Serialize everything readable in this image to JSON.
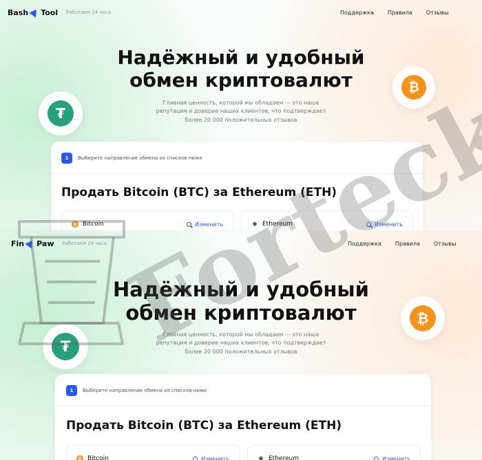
{
  "top": {
    "logo": {
      "left": "Bash",
      "right": "Tool"
    },
    "hours": "Работаем 24 часа",
    "nav": [
      "Поддержка",
      "Правила",
      "Отзывы"
    ]
  },
  "bottom": {
    "logo": {
      "left": "Fin",
      "right": "Paw"
    },
    "hours": "Работаем 24 часа",
    "nav": [
      "Поддержка",
      "Правила",
      "Отзывы"
    ]
  },
  "hero": {
    "title_line1": "Надёжный и удобный",
    "title_line2": "обмен криптовалют",
    "subtitle_line1": "Главная ценность, которой мы обладаем — это наша",
    "subtitle_line2": "репутация и доверие наших клиентов, что подтверждает",
    "subtitle_line3": "более 20 000 положительных отзывов"
  },
  "exchange": {
    "step_number": "1",
    "step_text": "Выберите направление обмена из списков ниже",
    "title": "Продать Bitcoin (BTC) за Ethereum (ETH)",
    "from": {
      "coin": "Bitcoin",
      "change_label": "Изменить"
    },
    "to": {
      "coin": "Ethereum",
      "change_label": "Изменить"
    }
  },
  "watermark": "Forteck",
  "colors": {
    "accent": "#2b58f0",
    "bitcoin": "#f7931a",
    "tether": "#26a17b"
  },
  "icons": {
    "bitcoin": "bitcoin-icon",
    "tether": "tether-icon",
    "ethereum": "ethereum-icon",
    "search": "search-icon",
    "logo": "paper-plane-icon"
  }
}
